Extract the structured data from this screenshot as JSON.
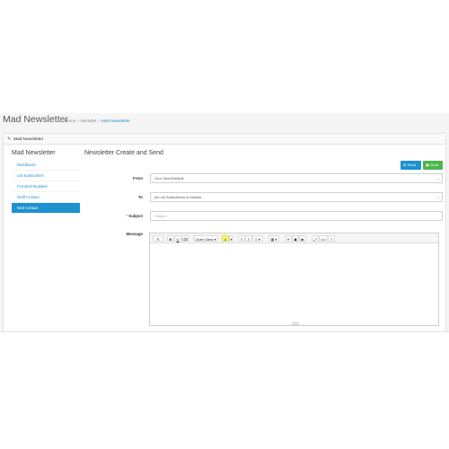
{
  "header": {
    "title": "Mad Newsletter",
    "breadcrumb": {
      "home": "Home",
      "modules": "Modules",
      "current": "Mad Newsletter"
    }
  },
  "panel": {
    "heading": "Mad Newsletter"
  },
  "sidebar": {
    "title": "Mad Newsletter",
    "items": [
      {
        "label": "Dashboard",
        "active": false
      },
      {
        "label": "List Subscribers",
        "active": false
      },
      {
        "label": "Frontend Modules",
        "active": false
      },
      {
        "label": "Draft Contact",
        "active": false
      },
      {
        "label": "Mail Contact",
        "active": true
      }
    ]
  },
  "main": {
    "title": "Newsletter Create and Send",
    "send_label": "Send",
    "draft_label": "Draft",
    "from_label": "From",
    "from_value": "Your Store/Default",
    "to_label": "To",
    "to_value": "All List Subscribers in Module",
    "subject_required": "*",
    "subject_label": "Subject",
    "subject_placeholder": "Subject",
    "message_label": "Message"
  },
  "toolbar": {
    "style": "✎",
    "bold": "B",
    "underline": "U",
    "eraser": "⌫",
    "font": "Open Sans",
    "color": "A",
    "ul": "≡",
    "ol": "≡",
    "align": "≡",
    "table": "▦",
    "link": "⚭",
    "image": "▣",
    "video": "▶",
    "fullscreen": "⤢",
    "code": "</>",
    "help": "?"
  },
  "colors": {
    "accent": "#1e91cf",
    "success": "#4cb64c",
    "required": "#f56b6b"
  }
}
